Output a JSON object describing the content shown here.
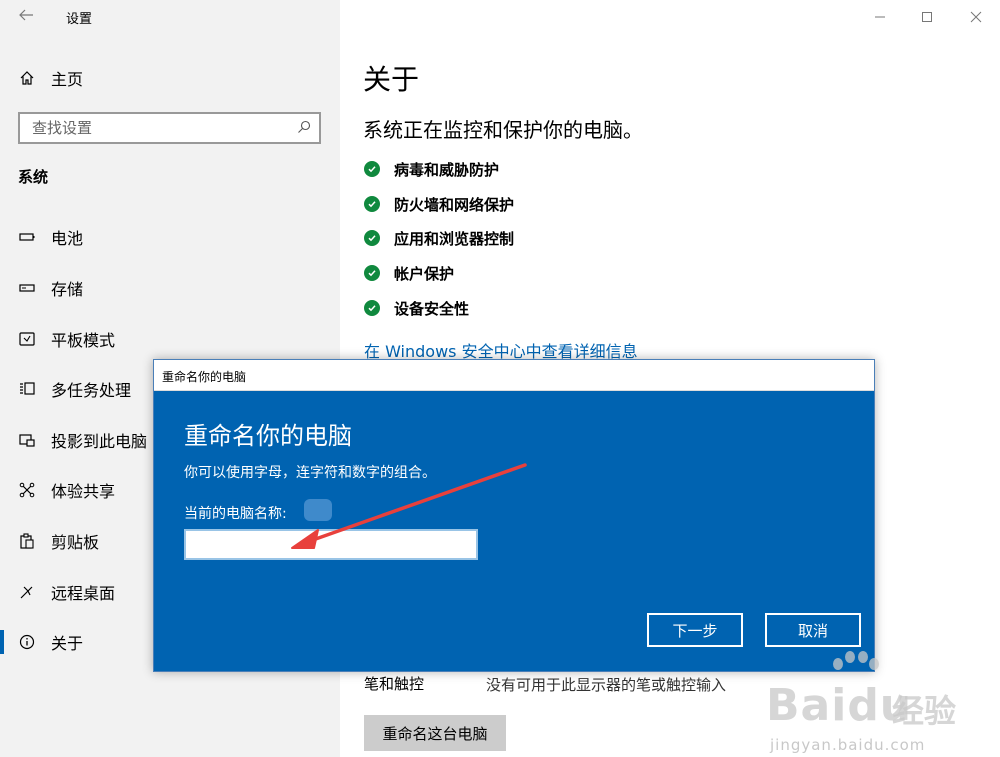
{
  "window": {
    "app_title": "设置"
  },
  "sidebar": {
    "home_label": "主页",
    "search_placeholder": "查找设置",
    "section_title": "系统",
    "items": [
      {
        "label": "电池",
        "icon": "battery-icon"
      },
      {
        "label": "存储",
        "icon": "storage-icon"
      },
      {
        "label": "平板模式",
        "icon": "tablet-mode-icon"
      },
      {
        "label": "多任务处理",
        "icon": "multitasking-icon"
      },
      {
        "label": "投影到此电脑",
        "icon": "project-icon"
      },
      {
        "label": "体验共享",
        "icon": "shared-experiences-icon"
      },
      {
        "label": "剪贴板",
        "icon": "clipboard-icon"
      },
      {
        "label": "远程桌面",
        "icon": "remote-desktop-icon"
      },
      {
        "label": "关于",
        "icon": "info-icon",
        "active": true
      }
    ]
  },
  "main": {
    "title": "关于",
    "subtitle": "系统正在监控和保护你的电脑。",
    "protections": [
      "病毒和威胁防护",
      "防火墙和网络保护",
      "应用和浏览器控制",
      "帐户保护",
      "设备安全性"
    ],
    "security_link": "在 Windows 安全中心中查看详细信息",
    "pen_label": "笔和触控",
    "pen_value": "没有可用于此显示器的笔或触控输入",
    "rename_button": "重命名这台电脑"
  },
  "dialog": {
    "window_title": "重命名你的电脑",
    "heading": "重命名你的电脑",
    "description": "你可以使用字母，连字符和数字的组合。",
    "current_name_label": "当前的电脑名称:",
    "input_value": "",
    "next_button": "下一步",
    "cancel_button": "取消"
  },
  "colors": {
    "accent": "#0063b1",
    "check_green": "#10893e",
    "annotation_arrow": "#e8403c"
  },
  "watermark": {
    "brand": "Bai",
    "brand_suffix": "du",
    "cn": "经验",
    "url": "jingyan.baidu.com"
  }
}
